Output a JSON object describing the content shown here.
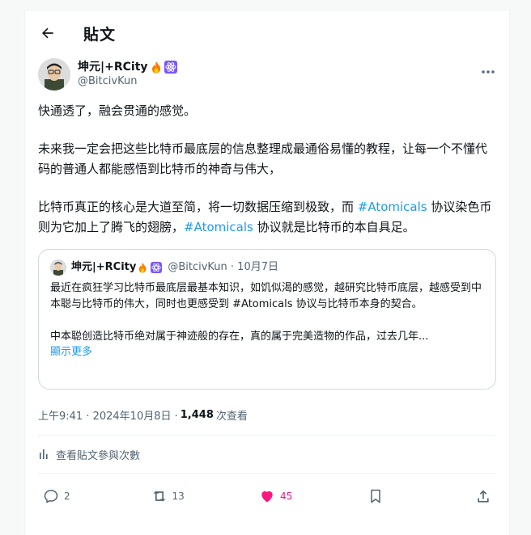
{
  "header": {
    "title": "貼文"
  },
  "author": {
    "name": "坤元|+RCity",
    "handle": "@BitcivKun"
  },
  "tweet": {
    "p1": "快通透了，融会贯通的感觉。",
    "p2": "未来我一定会把这些比特币最底层的信息整理成最通俗易懂的教程，让每一个不懂代码的普通人都能感悟到比特币的神奇与伟大，",
    "p3_a": "比特币真正的核心是大道至简，将一切数据压缩到极致，而 ",
    "p3_tag1": "#Atomicals",
    "p3_b": " 协议染色币则为它加上了腾飞的翅膀，",
    "p3_tag2": "#Atomicals",
    "p3_c": " 协议就是比特币的本自具足。"
  },
  "quote": {
    "name": "坤元|+RCity",
    "meta": "@BitcivKun · 10月7日",
    "p1": "最近在疯狂学习比特币最底层最基本知识，如饥似渴的感觉，越研究比特币底层，越感受到中本聪与比特币的伟大，同时也更感受到 #Atomicals 协议与比特币本身的契合。",
    "p2": "中本聪创造比特币绝对属于神迹般的存在，真的属于完美造物的作品，过去几年...",
    "show_more": "顯示更多"
  },
  "timestamp": {
    "time": "上午9:41 · 2024年10月8日 · ",
    "views": "1,448",
    "views_label": "次查看"
  },
  "analytics": {
    "label": "查看貼文參與次數"
  },
  "actions": {
    "replies": "2",
    "reposts": "13",
    "likes": "45"
  },
  "colors": {
    "accent": "#1d9bf0",
    "like": "#f91880",
    "badge": "#7856ff",
    "fire": "#ff7a00"
  },
  "icons": [
    "back-arrow-icon",
    "more-icon",
    "fire-icon",
    "react-badge-icon",
    "bar-chart-icon",
    "reply-icon",
    "repost-icon",
    "heart-icon",
    "bookmark-icon",
    "share-icon"
  ]
}
